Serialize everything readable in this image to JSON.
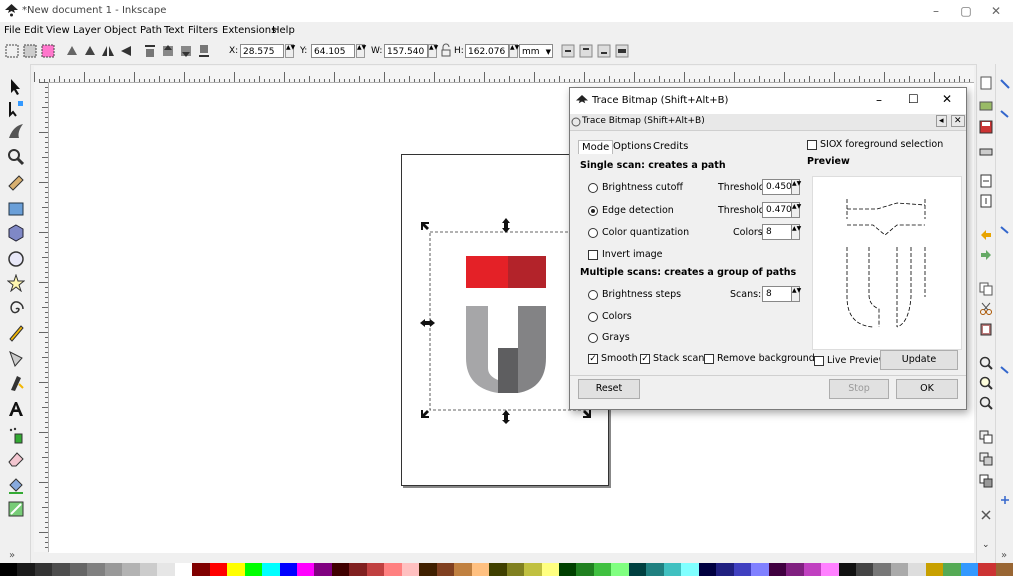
{
  "window": {
    "title": "*New document 1 - Inkscape",
    "minimize": "–",
    "restore": "▢",
    "close": "✕"
  },
  "menu": [
    "File",
    "Edit",
    "View",
    "Layer",
    "Object",
    "Path",
    "Text",
    "Filters",
    "Extensions",
    "Help"
  ],
  "toolbar": {
    "x_label": "X:",
    "x_value": "28.575",
    "y_label": "Y:",
    "y_value": "64.105",
    "w_label": "W:",
    "w_value": "157.540",
    "h_label": "H:",
    "h_value": "162.076",
    "unit": "mm"
  },
  "logo_colors": {
    "red_left": "#e42127",
    "red_right": "#b3232a",
    "gray_light": "#a6a6a8",
    "gray_mid": "#838385",
    "gray_dark": "#5e5e60"
  },
  "dialog": {
    "title": "Trace Bitmap (Shift+Alt+B)",
    "subtitle": "Trace Bitmap (Shift+Alt+B)",
    "tabs": [
      "Mode",
      "Options",
      "Credits"
    ],
    "single_scan_header": "Single scan: creates a path",
    "brightness_cutoff": "Brightness cutoff",
    "threshold_label": "Threshold:",
    "brightness_threshold": "0.450",
    "edge_detection": "Edge detection",
    "edge_threshold": "0.470",
    "color_quantization": "Color quantization",
    "colors_label": "Colors:",
    "colors_value": "8",
    "invert_image": "Invert image",
    "multi_scan_header": "Multiple scans: creates a group of paths",
    "brightness_steps": "Brightness steps",
    "scans_label": "Scans:",
    "scans_value": "8",
    "colors_option": "Colors",
    "grays_option": "Grays",
    "smooth": "Smooth",
    "stack_scans": "Stack scans",
    "remove_background": "Remove background",
    "siox": "SIOX foreground selection",
    "preview_label": "Preview",
    "live_preview": "Live Preview",
    "update": "Update",
    "reset": "Reset",
    "stop": "Stop",
    "ok": "OK"
  }
}
